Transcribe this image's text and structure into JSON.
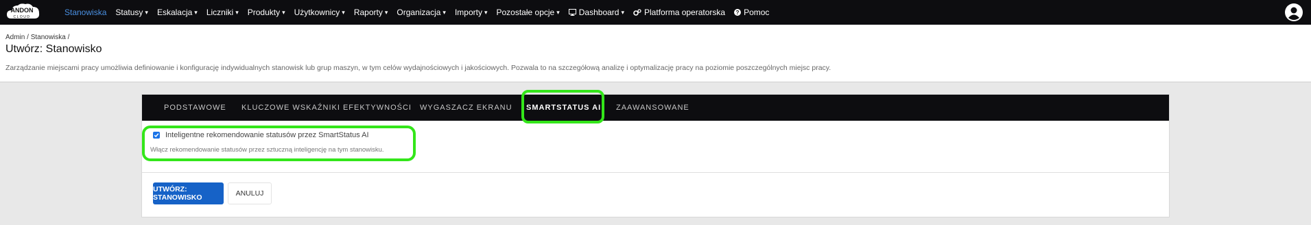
{
  "navbar": {
    "logo_text_top": "ANDON",
    "logo_text_bottom": "CLOUD",
    "items": [
      {
        "label": "Stanowiska",
        "active": true,
        "dropdown": false
      },
      {
        "label": "Statusy",
        "dropdown": true
      },
      {
        "label": "Eskalacja",
        "dropdown": true
      },
      {
        "label": "Liczniki",
        "dropdown": true
      },
      {
        "label": "Produkty",
        "dropdown": true
      },
      {
        "label": "Użytkownicy",
        "dropdown": true
      },
      {
        "label": "Raporty",
        "dropdown": true
      },
      {
        "label": "Organizacja",
        "dropdown": true
      },
      {
        "label": "Importy",
        "dropdown": true
      },
      {
        "label": "Pozostałe opcje",
        "dropdown": true
      },
      {
        "label": "Dashboard",
        "dropdown": true,
        "icon": "monitor-icon"
      },
      {
        "label": "Platforma operatorska",
        "dropdown": false,
        "icon": "cogs-icon"
      },
      {
        "label": "Pomoc",
        "dropdown": false,
        "icon": "question-circle-icon"
      }
    ],
    "caret": "▾",
    "user_icon": "user-circle-icon"
  },
  "header": {
    "breadcrumb": [
      "Admin",
      "Stanowiska"
    ],
    "breadcrumb_sep": "/",
    "title": "Utwórz: Stanowisko",
    "description": "Zarządzanie miejscami pracy umożliwia definiowanie i konfigurację indywidualnych stanowisk lub grup maszyn, w tym celów wydajnościowych i jakościowych. Pozwala to na szczegółową analizę i optymalizację pracy na poziomie poszczególnych miejsc pracy."
  },
  "tabs": [
    {
      "label": "PODSTAWOWE",
      "active": false
    },
    {
      "label": "KLUCZOWE WSKAŹNIKI EFEKTYWNOŚCI",
      "active": false
    },
    {
      "label": "WYGASZACZ EKRANU",
      "active": false
    },
    {
      "label": "SMARTSTATUS AI",
      "active": true
    },
    {
      "label": "ZAAWANSOWANE",
      "active": false
    }
  ],
  "smartstatus": {
    "checkbox_label": "Inteligentne rekomendowanie statusów przez SmartStatus AI",
    "checked": true,
    "hint": "Włącz rekomendowanie statusów przez sztuczną inteligencję na tym stanowisku."
  },
  "actions": {
    "submit_label": "UTWÓRZ: STANOWISKO",
    "cancel_label": "ANULUJ"
  },
  "colors": {
    "navbar_bg": "#0d0d10",
    "active_nav": "#4a90e2",
    "primary_button": "#1662c7",
    "highlight": "#33e61a"
  }
}
